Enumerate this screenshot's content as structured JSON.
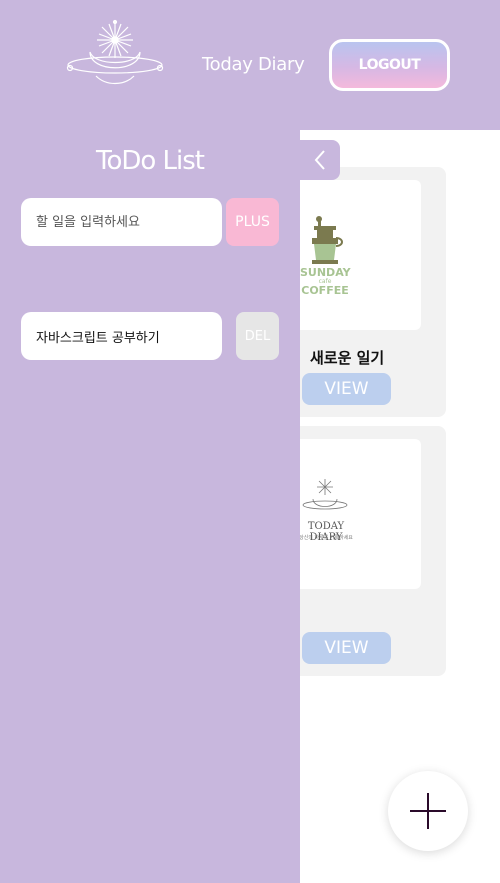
{
  "header": {
    "title": "Today Diary",
    "logout_label": "LOGOUT"
  },
  "sidebar": {
    "title": "ToDo List",
    "input_placeholder": "할 일을 입력하세요",
    "plus_label": "PLUS",
    "todos": [
      {
        "text": "자바스크립트 공부하기",
        "delete_label": "DEL"
      }
    ]
  },
  "cards": [
    {
      "title": "새로운 일기",
      "view_label": "VIEW",
      "thumb": {
        "brand_top": "SUNDAY",
        "brand_mid": "cafe",
        "brand_bottom": "COFFEE"
      }
    },
    {
      "title": "",
      "view_label": "VIEW",
      "thumb": {
        "brand_top": "TODAY DIARY",
        "brand_mid": "당신의 하루를 기록하세요"
      }
    }
  ],
  "colors": {
    "header_bg": "#c8b7dd",
    "plus_bg": "#f9b8d4",
    "view_bg": "#bccfee",
    "del_bg": "#e6e6e6"
  }
}
